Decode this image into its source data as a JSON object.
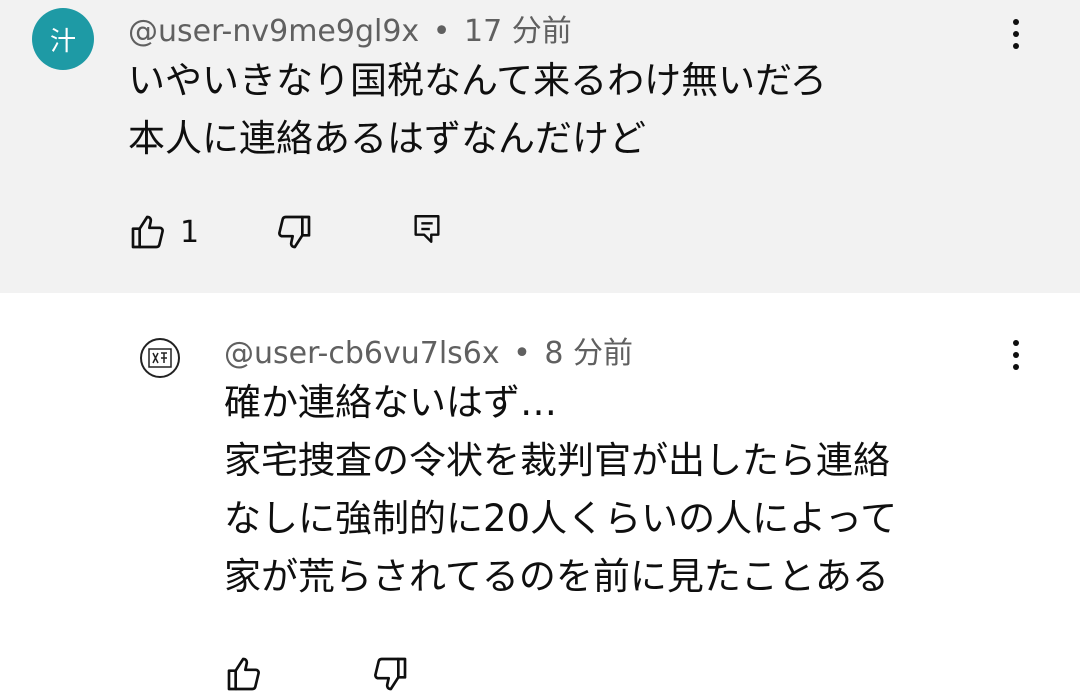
{
  "comment": {
    "avatar_char": "汁",
    "author": "@user-nv9me9gl9x",
    "separator": "•",
    "time": "17 分前",
    "text": "いやいきなり国税なんて来るわけ無いだろ\n本人に連絡あるはずなんだけど",
    "like_count": "1",
    "icons": {
      "like": "thumbs-up-icon",
      "dislike": "thumbs-down-icon",
      "reply": "reply-icon",
      "menu": "more-vert-icon"
    }
  },
  "reply": {
    "avatar_icon": "stamp-avatar-icon",
    "author": "@user-cb6vu7ls6x",
    "separator": "•",
    "time": "8 分前",
    "text": "確か連絡ないはず…\n家宅捜査の令状を裁判官が出したら連絡\nなしに強制的に20人くらいの人によって\n家が荒らされてるのを前に見たことある",
    "icons": {
      "like": "thumbs-up-icon",
      "dislike": "thumbs-down-icon",
      "menu": "more-vert-icon"
    }
  },
  "colors": {
    "highlight_background": "#f2f2f2",
    "avatar_teal": "#1e9aa5",
    "meta_text": "#606060",
    "body_text": "#0f0f0f"
  }
}
